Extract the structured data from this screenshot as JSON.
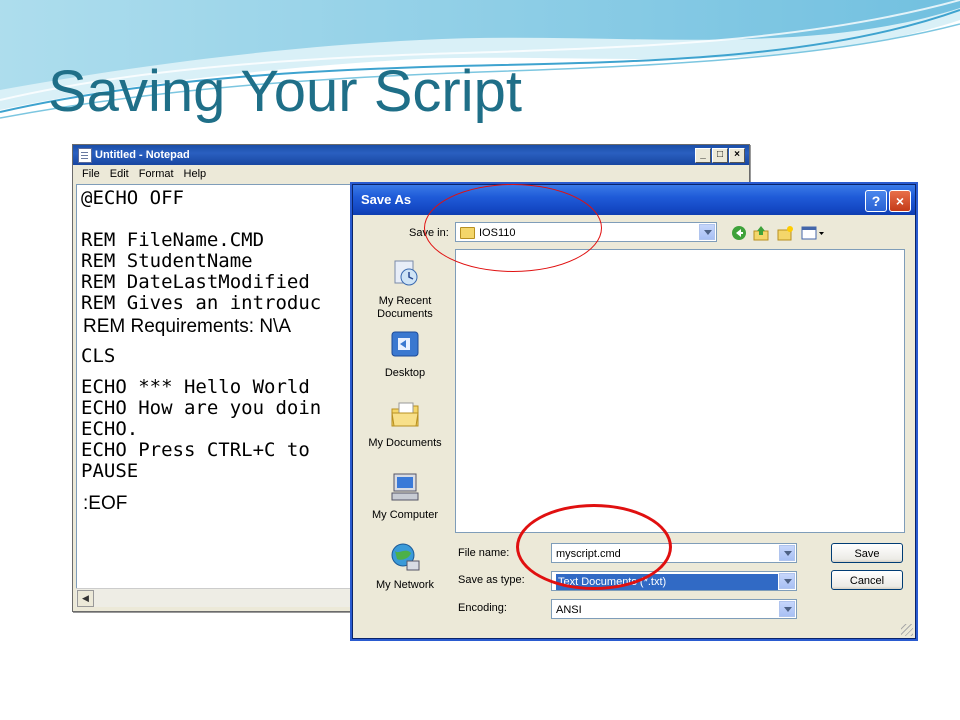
{
  "slide": {
    "title": "Saving Your Script"
  },
  "notepad": {
    "title": "Untitled - Notepad",
    "controls": {
      "minimize": "_",
      "maximize": "□",
      "close": "×"
    },
    "menu": [
      "File",
      "Edit",
      "Format",
      "Help"
    ],
    "lines": [
      "@ECHO OFF",
      "REM FileName.CMD",
      "REM StudentName",
      "REM DateLastModified",
      "REM Gives an introduc",
      "REM Requirements: N\\A",
      "CLS",
      "ECHO *** Hello World",
      "ECHO How are you doin",
      "ECHO.",
      "ECHO Press CTRL+C to",
      "PAUSE",
      ":EOF"
    ]
  },
  "dialog": {
    "title": "Save As",
    "help": "?",
    "close": "×",
    "save_in_label": "Save in:",
    "save_in_value": "IOS110",
    "places": [
      "My Recent\nDocuments",
      "Desktop",
      "My Documents",
      "My Computer",
      "My Network"
    ],
    "file_name_label": "File name:",
    "file_name_value": "myscript.cmd",
    "save_as_type_label": "Save as type:",
    "save_as_type_value": "Text Documents (*.txt)",
    "encoding_label": "Encoding:",
    "encoding_value": "ANSI",
    "save_button": "Save",
    "cancel_button": "Cancel"
  }
}
